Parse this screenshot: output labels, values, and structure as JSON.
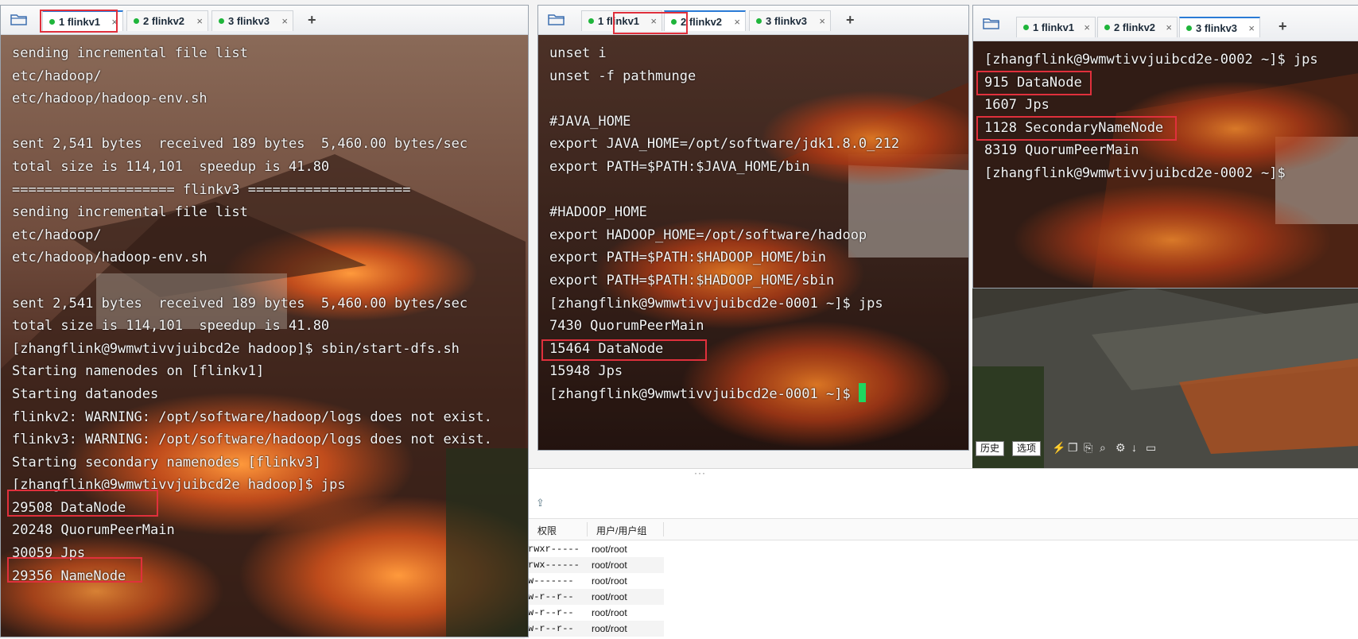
{
  "file_manager": {
    "headers": [
      "权限",
      "用户/用户组"
    ],
    "rows": [
      {
        "perm": "rwxr-----",
        "owner": "root/root"
      },
      {
        "perm": "rwx------",
        "owner": "root/root"
      },
      {
        "perm": "w-------",
        "owner": "root/root"
      },
      {
        "perm": "w-r--r--",
        "owner": "root/root"
      },
      {
        "perm": "w-r--r--",
        "owner": "root/root"
      },
      {
        "perm": "w-r--r--",
        "owner": "root/root"
      }
    ]
  },
  "sessions": [
    {
      "tabs": [
        {
          "label": "1 flinkv1"
        },
        {
          "label": "2 flinkv2"
        },
        {
          "label": "3 flinkv3"
        }
      ],
      "active": 0,
      "lines": [
        "sending incremental file list",
        "etc/hadoop/",
        "etc/hadoop/hadoop-env.sh",
        "",
        "sent 2,541 bytes  received 189 bytes  5,460.00 bytes/sec",
        "total size is 114,101  speedup is 41.80",
        "==================== flinkv3 ====================",
        "sending incremental file list",
        "etc/hadoop/",
        "etc/hadoop/hadoop-env.sh",
        "",
        "sent 2,541 bytes  received 189 bytes  5,460.00 bytes/sec",
        "total size is 114,101  speedup is 41.80",
        "[zhangflink@9wmwtivvjuibcd2e hadoop]$ sbin/start-dfs.sh",
        "Starting namenodes on [flinkv1]",
        "Starting datanodes",
        "flinkv2: WARNING: /opt/software/hadoop/logs does not exist.",
        "flinkv3: WARNING: /opt/software/hadoop/logs does not exist.",
        "Starting secondary namenodes [flinkv3]",
        "[zhangflink@9wmwtivvjuibcd2e hadoop]$ jps",
        "29508 DataNode",
        "20248 QuorumPeerMain",
        "30059 Jps",
        "29356 NameNode"
      ]
    },
    {
      "tabs": [
        {
          "label": "1 flinkv1"
        },
        {
          "label": "2 flinkv2"
        },
        {
          "label": "3 flinkv3"
        }
      ],
      "active": 1,
      "lines": [
        "unset i",
        "unset -f pathmunge",
        "",
        "#JAVA_HOME",
        "export JAVA_HOME=/opt/software/jdk1.8.0_212",
        "export PATH=$PATH:$JAVA_HOME/bin",
        "",
        "#HADOOP_HOME",
        "export HADOOP_HOME=/opt/software/hadoop",
        "export PATH=$PATH:$HADOOP_HOME/bin",
        "export PATH=$PATH:$HADOOP_HOME/sbin",
        "[zhangflink@9wmwtivvjuibcd2e-0001 ~]$ jps",
        "7430 QuorumPeerMain",
        "15464 DataNode",
        "15948 Jps",
        "[zhangflink@9wmwtivvjuibcd2e-0001 ~]$ "
      ]
    },
    {
      "tabs": [
        {
          "label": "1 flinkv1"
        },
        {
          "label": "2 flinkv2"
        },
        {
          "label": "3 flinkv3"
        }
      ],
      "active": 2,
      "lines": [
        "[zhangflink@9wmwtivvjuibcd2e-0002 ~]$ jps",
        "915 DataNode",
        "1607 Jps",
        "1128 SecondaryNameNode",
        "8319 QuorumPeerMain",
        "[zhangflink@9wmwtivvjuibcd2e-0002 ~]$ "
      ]
    }
  ],
  "toolbar": {
    "history": "历史",
    "options": "选项"
  },
  "colors": {
    "tab_dot": "#1fb53b",
    "highlight_box": "#e0303c",
    "cursor": "#1ed760"
  }
}
